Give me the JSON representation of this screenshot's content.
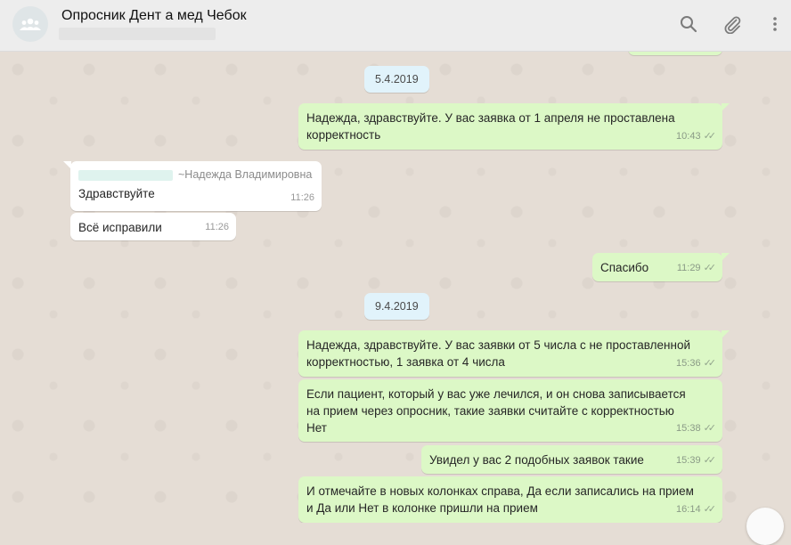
{
  "header": {
    "title": "Опросник Дент а мед Чебок"
  },
  "icons": {
    "avatar": "group-avatar-icon",
    "search": "search-icon",
    "attach": "paperclip-icon",
    "menu": "more-vertical-icon"
  },
  "colors": {
    "outgoing_bubble": "#dcf8c6",
    "incoming_bubble": "#ffffff",
    "date_pill": "#e1f3fb",
    "chat_bg": "#e5ddd5",
    "header_bg": "#ededed"
  },
  "dates": [
    "5.4.2019",
    "9.4.2019"
  ],
  "messages": [
    {
      "text": "Надежда, здравствуйте. У вас заявка от 1 апреля не проставлена корректность",
      "time": "10:43"
    },
    {
      "sender": "~Надежда Владимировна",
      "text": "Здравствуйте",
      "time": "11:26"
    },
    {
      "text": "Всё исправили",
      "time": "11:26"
    },
    {
      "text": "Спасибо",
      "time": "11:29"
    },
    {
      "text": "Надежда, здравствуйте. У вас заявки от 5 числа с не проставленной корректностью, 1 заявка от 4 числа",
      "time": "15:36"
    },
    {
      "text": "Если пациент, который у вас уже лечился, и он снова записывается на прием через опросник, такие заявки считайте с корректностью Нет",
      "time": "15:38"
    },
    {
      "text": "Увидел у вас 2 подобных заявок такие",
      "time": "15:39"
    },
    {
      "text": "И отмечайте в новых колонках справа, Да если записались на прием и Да или Нет в колонке пришли на прием",
      "time": "16:14"
    }
  ]
}
